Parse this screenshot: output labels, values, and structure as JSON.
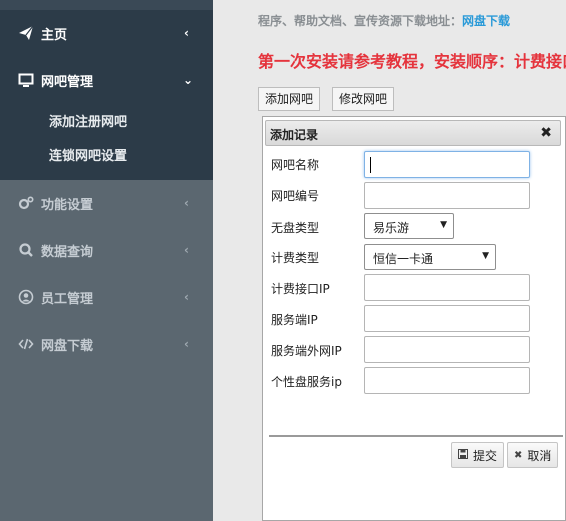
{
  "sidebar": {
    "items": [
      {
        "label": "主页",
        "icon": "paper-plane-icon"
      },
      {
        "label": "网吧管理",
        "icon": "monitor-icon"
      },
      {
        "label": "功能设置",
        "icon": "gears-icon"
      },
      {
        "label": "数据查询",
        "icon": "search-icon"
      },
      {
        "label": "员工管理",
        "icon": "user-icon"
      },
      {
        "label": "网盘下载",
        "icon": "code-icon"
      }
    ],
    "sub_items": [
      "添加注册网吧",
      "连锁网吧设置"
    ]
  },
  "main": {
    "info_text": "程序、帮助文档、宣传资源下载地址：",
    "info_link": "网盘下载",
    "notice": "第一次安装请参考教程，安装顺序：计费接口",
    "tabs": [
      "添加网吧",
      "修改网吧"
    ]
  },
  "dialog": {
    "title": "添加记录",
    "fields": [
      {
        "label": "网吧名称",
        "value": ""
      },
      {
        "label": "网吧编号",
        "value": ""
      },
      {
        "label": "无盘类型",
        "value": "易乐游"
      },
      {
        "label": "计费类型",
        "value": "恒信一卡通"
      },
      {
        "label": "计费接口IP",
        "value": ""
      },
      {
        "label": "服务端IP",
        "value": ""
      },
      {
        "label": "服务端外网IP",
        "value": ""
      },
      {
        "label": "个性盘服务ip",
        "value": ""
      }
    ],
    "submit_label": "提交",
    "cancel_label": "取消"
  },
  "colors": {
    "sidebar_dark": "#2c3b48",
    "sidebar_light": "#5b6770",
    "link": "#2a9ad8",
    "notice": "#e5343d"
  }
}
